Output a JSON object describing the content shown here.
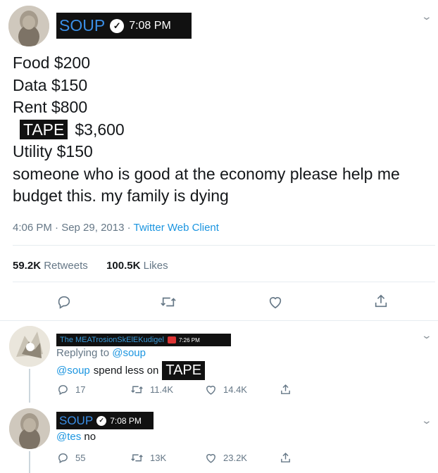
{
  "tweet": {
    "author_name": "SOUP",
    "time_overlay": "7:08 PM",
    "lines": [
      "Food $200",
      "Data $150",
      "Rent $800"
    ],
    "tape_label": "TAPE",
    "tape_amount": "$3,600",
    "line_utility": "Utility $150",
    "line_plea1": "someone who is good at the economy please help me",
    "line_plea2": "budget this. my family is dying",
    "timestamp": "4:06 PM · Sep 29, 2013 ·",
    "client": "Twitter Web Client",
    "retweets_count": "59.2K",
    "retweets_label": "Retweets",
    "likes_count": "100.5K",
    "likes_label": "Likes"
  },
  "reply1": {
    "author_name": "The MEATrosionSkElEKudigel",
    "time_overlay": "7:26 PM",
    "replying_label": "Replying to",
    "replying_handle": "@soup",
    "mention": "@soup",
    "text": "spend less on",
    "tape_label": "TAPE",
    "replies": "17",
    "retweets": "11.4K",
    "likes": "14.4K"
  },
  "reply2": {
    "author_name": "SOUP",
    "time_overlay": "7:08 PM",
    "mention": "@tes",
    "text": "no",
    "replies": "55",
    "retweets": "13K",
    "likes": "23.2K"
  },
  "icons": [
    "chevron-down-icon",
    "verified-check-icon",
    "reply-icon",
    "retweet-icon",
    "like-icon",
    "share-icon",
    "flag-icon"
  ],
  "colors": {
    "link": "#1b95e0",
    "name_overlay": "#3a8ee6",
    "text": "#14171a",
    "muted": "#657786",
    "divider": "#e6ecf0"
  }
}
